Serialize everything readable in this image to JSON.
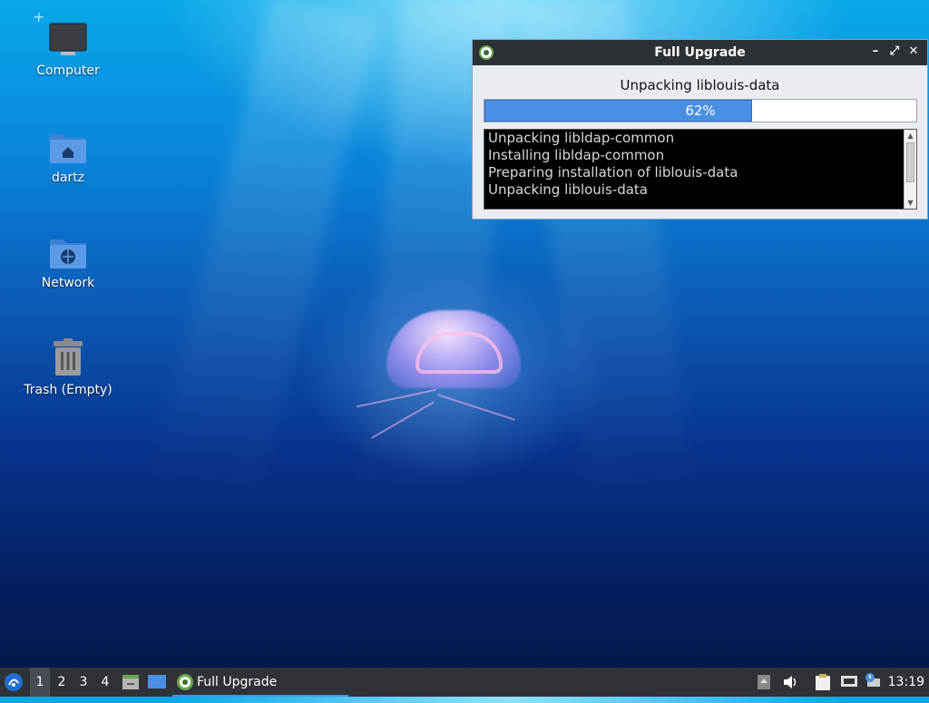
{
  "desktop": {
    "icons": [
      {
        "label": "Computer",
        "icon": "monitor-icon"
      },
      {
        "label": "dartz",
        "icon": "home-folder-icon"
      },
      {
        "label": "Network",
        "icon": "network-folder-icon"
      },
      {
        "label": "Trash (Empty)",
        "icon": "trash-icon"
      }
    ]
  },
  "window": {
    "title": "Full Upgrade",
    "status": "Unpacking liblouis-data",
    "progress_percent": 62,
    "progress_label": "62%",
    "log_lines": [
      "Unpacking libldap-common",
      "Installing libldap-common",
      "Preparing installation of liblouis-data",
      "Unpacking liblouis-data"
    ],
    "controls": {
      "minimize": "–",
      "maximize": "⤢",
      "close": "✕"
    }
  },
  "taskbar": {
    "workspaces": [
      "1",
      "2",
      "3",
      "4"
    ],
    "active_workspace": "1",
    "task_label": "Full Upgrade",
    "clock": "13:19"
  },
  "colors": {
    "accent": "#4a90e2",
    "titlebar": "#2c3135",
    "taskbar": "#2f3237"
  }
}
